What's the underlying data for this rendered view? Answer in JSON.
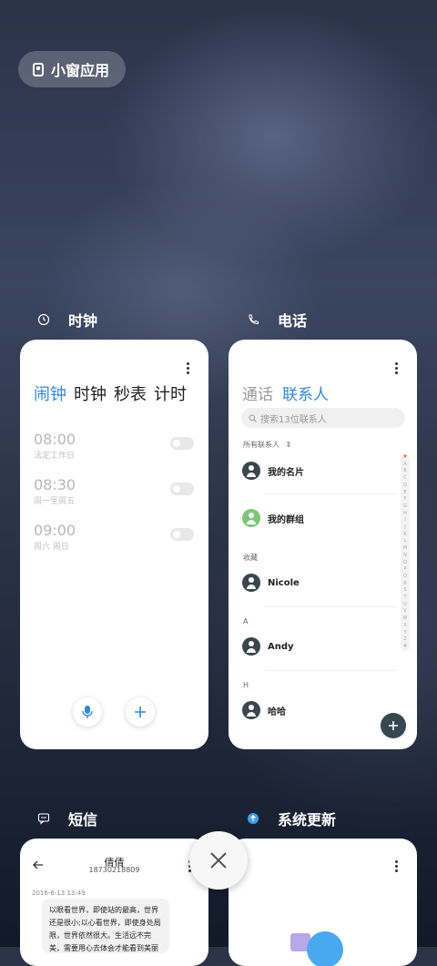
{
  "pill": {
    "label": "小窗应用"
  },
  "apps": {
    "clock": {
      "title": "时钟",
      "tabs": [
        "闹钟",
        "时钟",
        "秒表",
        "计时"
      ],
      "alarms": [
        {
          "time": "08:00",
          "repeat": "法定工作日"
        },
        {
          "time": "08:30",
          "repeat": "周一至周五"
        },
        {
          "time": "09:00",
          "repeat": "周六 周日"
        }
      ]
    },
    "phone": {
      "title": "电话",
      "tabs": [
        "通话",
        "联系人"
      ],
      "search_placeholder": "搜索13位联系人",
      "all_contacts": "所有联系人",
      "my_card": "我的名片",
      "my_groups": "我的群组",
      "favorites_label": "收藏",
      "favorite_contact": "Nicole",
      "section_a": "A",
      "contact_a": "Andy",
      "section_h": "H",
      "contact_h": "哈哈",
      "index_letters": "♥ABCDEFGHIJKLMNOPQRSTUVWXYZ#"
    },
    "sms": {
      "title": "短信",
      "contact_name": "倩倩",
      "phone_number": "18730218809",
      "date": "2016-6-13 13:49",
      "message": "以眼看世界，即使站的最高，世界还是很小;以心看世界，即使身处局限，世界依然很大。生活远不完美，需要用心去体会才能看到美丽"
    },
    "update": {
      "title": "系统更新"
    }
  },
  "colors": {
    "accent": "#2f8ae5",
    "fab": "#37474f"
  }
}
